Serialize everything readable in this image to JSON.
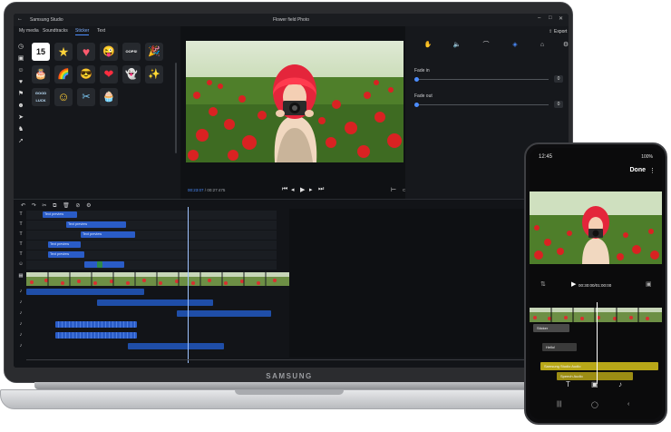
{
  "laptop": {
    "brand": "SAMSUNG",
    "titlebar": {
      "app_name": "Samsung Studio",
      "doc_title": "Flower field Photo",
      "back_icon": "arrow-left-icon"
    },
    "tabs": [
      {
        "label": "My media"
      },
      {
        "label": "Soundtracks"
      },
      {
        "label": "Sticker",
        "active": true
      },
      {
        "label": "Text"
      }
    ],
    "export_label": "Export",
    "stickers": [
      {
        "icon": "fifteen-badge-sticker",
        "glyph": "15"
      },
      {
        "icon": "star-sticker",
        "glyph": "★"
      },
      {
        "icon": "heart-sticker",
        "glyph": "♥"
      },
      {
        "icon": "laughing-face-sticker",
        "glyph": "😜"
      },
      {
        "icon": "oops-sticker",
        "glyph": "OOPS!"
      },
      {
        "icon": "party-popper-sticker",
        "glyph": "🎉"
      },
      {
        "icon": "cake-sticker",
        "glyph": "🎂"
      },
      {
        "icon": "rainbow-sticker",
        "glyph": "🌈"
      },
      {
        "icon": "cool-face-sticker",
        "glyph": "😎"
      },
      {
        "icon": "red-heart-sticker",
        "glyph": "❤"
      },
      {
        "icon": "ghost-sticker",
        "glyph": "👻"
      },
      {
        "icon": "sparkle-sticker",
        "glyph": "✨"
      },
      {
        "icon": "good-luck-sticker",
        "glyph": "GOOD LUCK"
      },
      {
        "icon": "smiley-face-sticker",
        "glyph": "☺"
      },
      {
        "icon": "hairdryer-sticker",
        "glyph": "✂"
      },
      {
        "icon": "cupcake-sticker",
        "glyph": "🧁"
      }
    ],
    "preview": {
      "current_time": "00:23:07",
      "total_time": "00:27:475"
    },
    "effects": {
      "fade_in_label": "Fade in",
      "fade_in_value": "0",
      "fade_out_label": "Fade out",
      "fade_out_value": "0"
    },
    "timeline": {
      "text_clips": [
        {
          "label": "Text preview"
        },
        {
          "label": "Text preview"
        },
        {
          "label": "Text preview"
        },
        {
          "label": "Text preview"
        },
        {
          "label": "Text preview"
        }
      ]
    }
  },
  "phone": {
    "time": "12:45",
    "battery": "100%",
    "done_label": "Done",
    "playback_time": "00:30:00/01:00:00",
    "tracks": {
      "sticker_label": "Sticker",
      "text_label": "Hello!",
      "audio_label": "Samsung Studio Audio",
      "speech_label": "Speech Audio"
    }
  },
  "colors": {
    "accent": "#4c8dff",
    "clip_blue": "#2a5cc7",
    "phone_track_yellow": "#b8a718"
  }
}
